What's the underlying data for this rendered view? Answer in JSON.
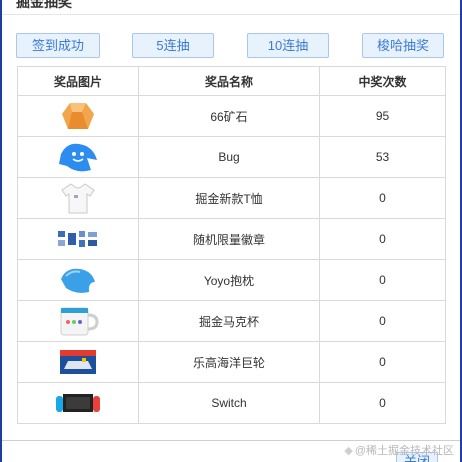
{
  "modal": {
    "title": "掘金抽奖",
    "footer_button": "关闭"
  },
  "toolbar": {
    "checkin_label": "签到成功",
    "draw5_label": "5连抽",
    "draw10_label": "10连抽",
    "suoha_label": "梭哈抽奖"
  },
  "table": {
    "headers": [
      "奖品图片",
      "奖品名称",
      "中奖次数"
    ],
    "rows": [
      {
        "icon": "ore-icon",
        "name": "66矿石",
        "count": "95"
      },
      {
        "icon": "bug-icon",
        "name": "Bug",
        "count": "53"
      },
      {
        "icon": "tshirt-icon",
        "name": "掘金新款T恤",
        "count": "0"
      },
      {
        "icon": "badges-icon",
        "name": "随机限量徽章",
        "count": "0"
      },
      {
        "icon": "pillow-icon",
        "name": "Yoyo抱枕",
        "count": "0"
      },
      {
        "icon": "mug-icon",
        "name": "掘金马克杯",
        "count": "0"
      },
      {
        "icon": "lego-ship-icon",
        "name": "乐高海洋巨轮",
        "count": "0"
      },
      {
        "icon": "switch-console-icon",
        "name": "Switch",
        "count": "0"
      }
    ]
  },
  "watermark": "@稀土掘金技术社区",
  "colors": {
    "accent": "#3a7bd5",
    "button_bg": "#e8f2fd",
    "backdrop": "#1f3fa0"
  }
}
